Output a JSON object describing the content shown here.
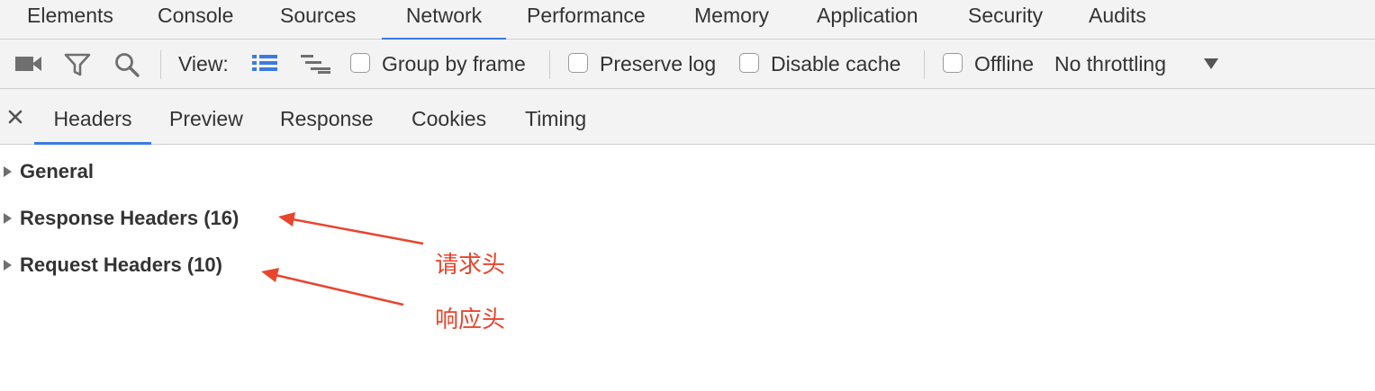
{
  "panel_tabs": [
    "Elements",
    "Console",
    "Sources",
    "Network",
    "Performance",
    "Memory",
    "Application",
    "Security",
    "Audits"
  ],
  "active_panel_tab": "Network",
  "toolbar": {
    "view_label": "View:",
    "group_by_frame": "Group by frame",
    "preserve_log": "Preserve log",
    "disable_cache": "Disable cache",
    "offline": "Offline",
    "throttling": "No throttling",
    "icons": [
      "record-icon",
      "filter-icon",
      "search-icon",
      "list-view-icon",
      "waterfall-view-icon",
      "dropdown-arrow-icon"
    ]
  },
  "detail_tabs": [
    "Headers",
    "Preview",
    "Response",
    "Cookies",
    "Timing"
  ],
  "active_detail_tab": "Headers",
  "sections": {
    "general": "General",
    "response_headers": "Response Headers (16)",
    "request_headers": "Request Headers (10)"
  },
  "annotations": {
    "first": "请求头",
    "second": "响应头"
  },
  "colors": {
    "accent_blue": "#3b7be0",
    "annotation_red": "#e8452e",
    "toolbar_bg": "#f3f3f3"
  }
}
